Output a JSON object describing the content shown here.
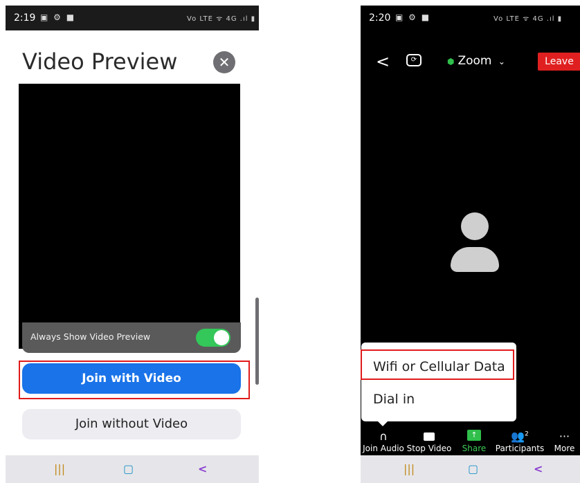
{
  "left": {
    "status": {
      "time": "2:19",
      "icons": "▣ ⚙ ■",
      "right": "Vo LTE ᯤ 4G .ıl ▮"
    },
    "title": "Video Preview",
    "close_icon": "✕",
    "preview_label": "Always Show Video Preview",
    "join_video": "Join with Video",
    "join_no_video": "Join without Video",
    "nav": {
      "recents": "|||",
      "home": "▢",
      "back": "<"
    }
  },
  "right": {
    "status": {
      "time": "2:20",
      "icons": "▣ ⚙ ■",
      "right": "Vo LTE ᯤ 4G .ıl ▮"
    },
    "back_icon": "<",
    "meeting_name": "Zoom",
    "dropdown_icon": "⌄",
    "leave": "Leave",
    "menu": {
      "item1": "Wifi or Cellular Data",
      "item2": "Dial in"
    },
    "toolbar": [
      {
        "label": "Join Audio",
        "icon": "headphones-icon"
      },
      {
        "label": "Stop Video",
        "icon": "video-camera-icon"
      },
      {
        "label": "Share",
        "icon": "share-icon"
      },
      {
        "label": "Participants",
        "icon": "participants-icon",
        "count": "2"
      },
      {
        "label": "More",
        "icon": "more-icon"
      }
    ],
    "nav": {
      "recents": "|||",
      "home": "▢",
      "back": "<"
    }
  },
  "colors": {
    "primary": "#1a73e8",
    "leave": "#e02020",
    "highlight": "#e01b1b",
    "share": "#2fbf4a"
  }
}
